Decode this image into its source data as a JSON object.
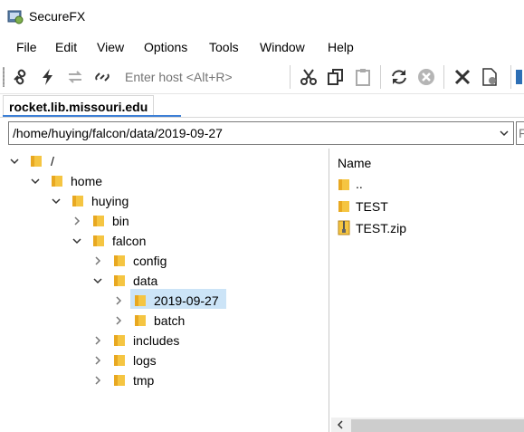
{
  "window": {
    "title": "SecureFX"
  },
  "menu": [
    "File",
    "Edit",
    "View",
    "Options",
    "Tools",
    "Window",
    "Help"
  ],
  "toolbar": {
    "host_placeholder": "Enter host <Alt+R>",
    "icons": [
      "connect-icon",
      "quick-connect-icon",
      "reconnect-icon",
      "disconnect-icon",
      "cut-icon",
      "copy-icon",
      "paste-icon",
      "refresh-icon",
      "stop-icon",
      "delete-icon",
      "properties-icon"
    ]
  },
  "tab": {
    "label": "rocket.lib.missouri.edu"
  },
  "path": {
    "value": "/home/huying/falcon/data/2019-09-27",
    "right_value": "F"
  },
  "tree": [
    {
      "label": "/",
      "level": 0,
      "expanded": true
    },
    {
      "label": "home",
      "level": 1,
      "expanded": true
    },
    {
      "label": "huying",
      "level": 2,
      "expanded": true
    },
    {
      "label": "bin",
      "level": 3,
      "expanded": false
    },
    {
      "label": "falcon",
      "level": 3,
      "expanded": true
    },
    {
      "label": "config",
      "level": 4,
      "expanded": false
    },
    {
      "label": "data",
      "level": 4,
      "expanded": true
    },
    {
      "label": "2019-09-27",
      "level": 5,
      "expanded": false,
      "selected": true
    },
    {
      "label": "batch",
      "level": 5,
      "expanded": false
    },
    {
      "label": "includes",
      "level": 4,
      "expanded": false
    },
    {
      "label": "logs",
      "level": 4,
      "expanded": false
    },
    {
      "label": "tmp",
      "level": 4,
      "expanded": false
    }
  ],
  "file_list": {
    "column_name": "Name",
    "items": [
      {
        "name": "..",
        "type": "folder"
      },
      {
        "name": "TEST",
        "type": "folder"
      },
      {
        "name": "TEST.zip",
        "type": "zip"
      }
    ]
  },
  "colors": {
    "folder": "#f5c542",
    "selection": "#cce4f7",
    "tab_accent": "#3c7fd6"
  }
}
